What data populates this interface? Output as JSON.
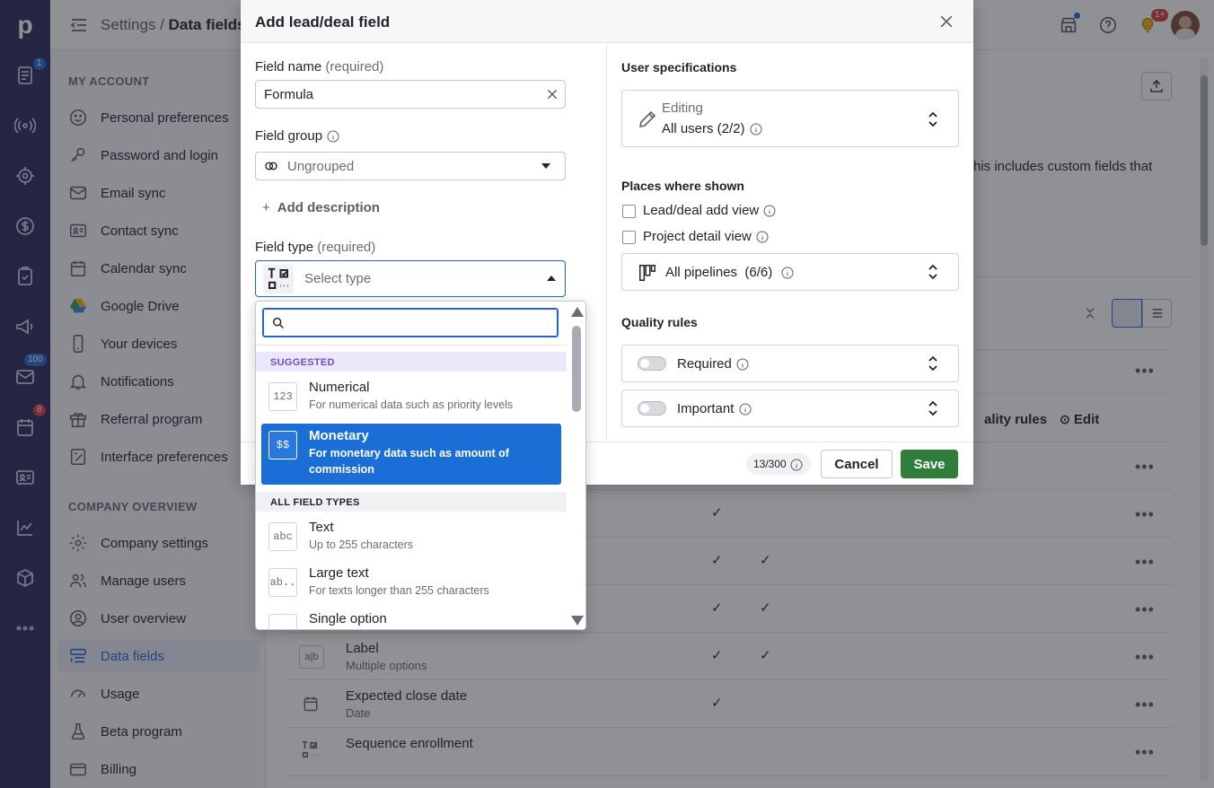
{
  "app": {
    "logo": "p"
  },
  "rail": {
    "items": [
      {
        "icon": "deals-icon",
        "badge": "1"
      },
      {
        "icon": "leads-icon",
        "badge": ""
      },
      {
        "icon": "target-icon",
        "badge": ""
      },
      {
        "icon": "dollar-icon",
        "badge": ""
      },
      {
        "icon": "tasks-icon",
        "badge": ""
      },
      {
        "icon": "campaigns-icon",
        "badge": ""
      },
      {
        "icon": "mail-icon",
        "badge": "100"
      },
      {
        "icon": "calendar-icon",
        "badge": "8"
      },
      {
        "icon": "contacts-icon",
        "badge": ""
      },
      {
        "icon": "insights-icon",
        "badge": ""
      },
      {
        "icon": "products-icon",
        "badge": ""
      },
      {
        "icon": "more-icon",
        "badge": ""
      }
    ]
  },
  "topbar": {
    "crumb_root": "Settings",
    "crumb_sep": "/",
    "crumb_current": "Data fields",
    "notif_badge": "1+"
  },
  "sidebar": {
    "my_account_heading": "MY ACCOUNT",
    "my_account": [
      {
        "label": "Personal preferences",
        "icon": "smile-icon"
      },
      {
        "label": "Password and login",
        "icon": "key-icon"
      },
      {
        "label": "Email sync",
        "icon": "mail-icon"
      },
      {
        "label": "Contact sync",
        "icon": "contact-card-icon"
      },
      {
        "label": "Calendar sync",
        "icon": "calendar-icon"
      },
      {
        "label": "Google Drive",
        "icon": "google-drive-icon"
      },
      {
        "label": "Your devices",
        "icon": "phone-icon"
      },
      {
        "label": "Notifications",
        "icon": "bell-icon"
      },
      {
        "label": "Referral program",
        "icon": "gift-icon"
      },
      {
        "label": "Interface preferences",
        "icon": "interface-icon"
      }
    ],
    "company_heading": "COMPANY OVERVIEW",
    "company": [
      {
        "label": "Company settings",
        "icon": "gear-icon"
      },
      {
        "label": "Manage users",
        "icon": "users-icon"
      },
      {
        "label": "User overview",
        "icon": "user-circle-icon"
      },
      {
        "label": "Data fields",
        "icon": "data-fields-icon"
      },
      {
        "label": "Usage",
        "icon": "gauge-icon"
      },
      {
        "label": "Beta program",
        "icon": "flask-icon"
      },
      {
        "label": "Billing",
        "icon": "card-icon"
      }
    ]
  },
  "main": {
    "desc_fragment": "his includes custom fields that",
    "col_quality": "ality rules",
    "col_edit": "Edit",
    "rows": [
      {
        "title": "Label",
        "sub": "Multiple options"
      },
      {
        "title": "Expected close date",
        "sub": "Date"
      },
      {
        "title": "Sequence enrollment",
        "sub": ""
      }
    ],
    "checkmark": "✓",
    "more": "•••"
  },
  "modal": {
    "title": "Add lead/deal field",
    "field_name_label": "Field name",
    "required_suffix": "(required)",
    "field_name_value": "Formula",
    "field_group_label": "Field group",
    "field_group_value": "Ungrouped",
    "add_description": "Add description",
    "field_type_label": "Field type",
    "field_type_placeholder": "Select type",
    "user_spec_title": "User specifications",
    "editing_label": "Editing",
    "editing_value": "All users (2/2)",
    "places_title": "Places where shown",
    "lead_deal_add_view": "Lead/deal add view",
    "project_detail_view": "Project detail view",
    "pipelines_value": "All pipelines",
    "pipelines_count": "(6/6)",
    "quality_title": "Quality rules",
    "required_label": "Required",
    "important_label": "Important",
    "counter": "13/300",
    "cancel": "Cancel",
    "save": "Save"
  },
  "dropdown": {
    "search_placeholder": "",
    "suggested_heading": "SUGGESTED",
    "all_heading": "ALL FIELD TYPES",
    "suggested": [
      {
        "icon_text": "123",
        "title": "Numerical",
        "desc": "For numerical data such as priority levels",
        "selected": false
      },
      {
        "icon_text": "$$",
        "title": "Monetary",
        "desc": "For monetary data such as amount of commission",
        "selected": true
      }
    ],
    "all": [
      {
        "icon_text": "abc",
        "title": "Text",
        "desc": "Up to 255 characters"
      },
      {
        "icon_text": "ab..",
        "title": "Large text",
        "desc": "For texts longer than 255 characters"
      },
      {
        "icon_text": "",
        "title": "Single option",
        "desc": ""
      }
    ]
  },
  "colors": {
    "rail": "#26285a",
    "accent": "#2366d1",
    "save": "#2f7d3b",
    "selected": "#1a6ed6",
    "suggested_bg": "#ece8fb"
  }
}
